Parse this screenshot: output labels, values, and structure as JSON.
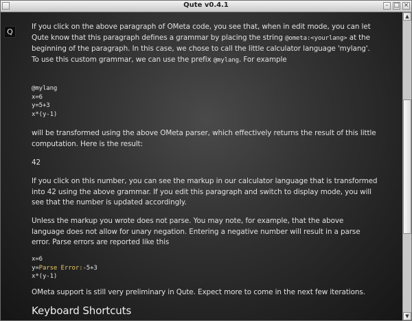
{
  "window": {
    "title": "Qute v0.4.1",
    "menu_icon": "window-menu-icon",
    "min_icon": "minimize-icon",
    "max_icon": "maximize-icon",
    "close_icon": "close-icon",
    "min_glyph": "–",
    "max_glyph": "□",
    "close_glyph": "×"
  },
  "app": {
    "logo_letter": "Q"
  },
  "document": {
    "intro": {
      "t1": "If you click on the above paragraph of OMeta code, you see that, when in edit mode, you can let Qute know that this paragraph defines a grammar by placing the string ",
      "code1": "@ometa:<yourlang>",
      "t2": " at the beginning of the paragraph. In this case, we chose to call the little calculator language 'mylang'. To use this custom grammar, we can use the prefix ",
      "code2": "@mylang",
      "t3": ". For example"
    },
    "code_example": [
      "@mylang",
      "x=6",
      "y=5+3",
      "x*(y-1)"
    ],
    "transformed_text": "will be transformed using the above OMeta parser, which effectively returns the result of this little computation. Here is the result:",
    "result": "42",
    "click_text": "If you click on this number, you can see the markup in our calculator language that is transformed into 42 using the above grammar. If you edit this paragraph and switch to display mode, you will see that the number is updated accordingly.",
    "unless_text": "Unless the markup you wrote does not parse. You may note, for example, that the above language does not allow for unary negation. Entering a negative number will result in a parse error. Parse errors are reported like this",
    "error_example": {
      "line1": "x=6",
      "line2_prefix": "y=",
      "line2_error": "Parse Error:",
      "line2_suffix": "-5+3",
      "line3": "x*(y-1)"
    },
    "ometa_text": "OMeta support is still very preliminary in Qute. Expect more to come in the next few iterations.",
    "heading": "Keyboard Shortcuts"
  },
  "scrollbar": {
    "up_glyph": "▲",
    "down_glyph": "▼",
    "position_fraction": 0.5
  },
  "colors": {
    "error_text": "#e8c86a",
    "body_text": "#e2e2e2"
  }
}
